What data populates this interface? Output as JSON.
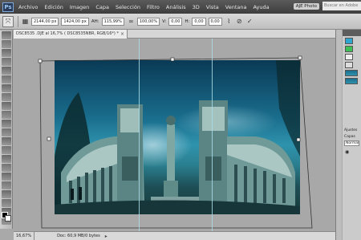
{
  "app": {
    "logo": "Ps",
    "menus": [
      "Archivo",
      "Edición",
      "Imagen",
      "Capa",
      "Selección",
      "Filtro",
      "Análisis",
      "3D",
      "Vista",
      "Ventana",
      "Ayuda"
    ],
    "workspace_label": "AJE Photo",
    "search_placeholder": "Buscar en Adobe"
  },
  "options_bar": {
    "fields": [
      "2144,00 px",
      "1424,00 px",
      "115,99%",
      "100,00%",
      "0,00",
      "0,00"
    ],
    "labels": [
      "AH:",
      "V:",
      "H:"
    ],
    "right_fields": [
      "0,00",
      "0,00"
    ]
  },
  "document": {
    "tab_title": "DSC8535 .DJE al 16,7% ( DSC8535NBR, RGB/16*) *",
    "tab_close": "×"
  },
  "status": {
    "zoom": "16,67%",
    "doc_info": "Doc: 60,9 MB/0 bytes"
  },
  "right_panels": {
    "adjust_tab": "Ajustes",
    "layers_tab": "Capas",
    "blend_mode": "Normal",
    "eye_icon": "eye-icon"
  },
  "colors": {
    "menubar": "#4a4a4a",
    "panel": "#bfbfbf",
    "canvas_bg": "#a8a8a8",
    "guide": "#aadce6"
  },
  "tool_icons": [
    "move-icon",
    "marquee-icon",
    "lasso-icon",
    "quick-select-icon",
    "crop-icon",
    "eyedropper-icon",
    "healing-icon",
    "brush-icon",
    "clone-stamp-icon",
    "history-brush-icon",
    "eraser-icon",
    "gradient-icon",
    "blur-icon",
    "dodge-icon",
    "pen-icon",
    "type-icon",
    "path-select-icon",
    "shape-icon",
    "3d-rotate-icon",
    "3d-camera-icon",
    "hand-icon",
    "zoom-icon"
  ]
}
